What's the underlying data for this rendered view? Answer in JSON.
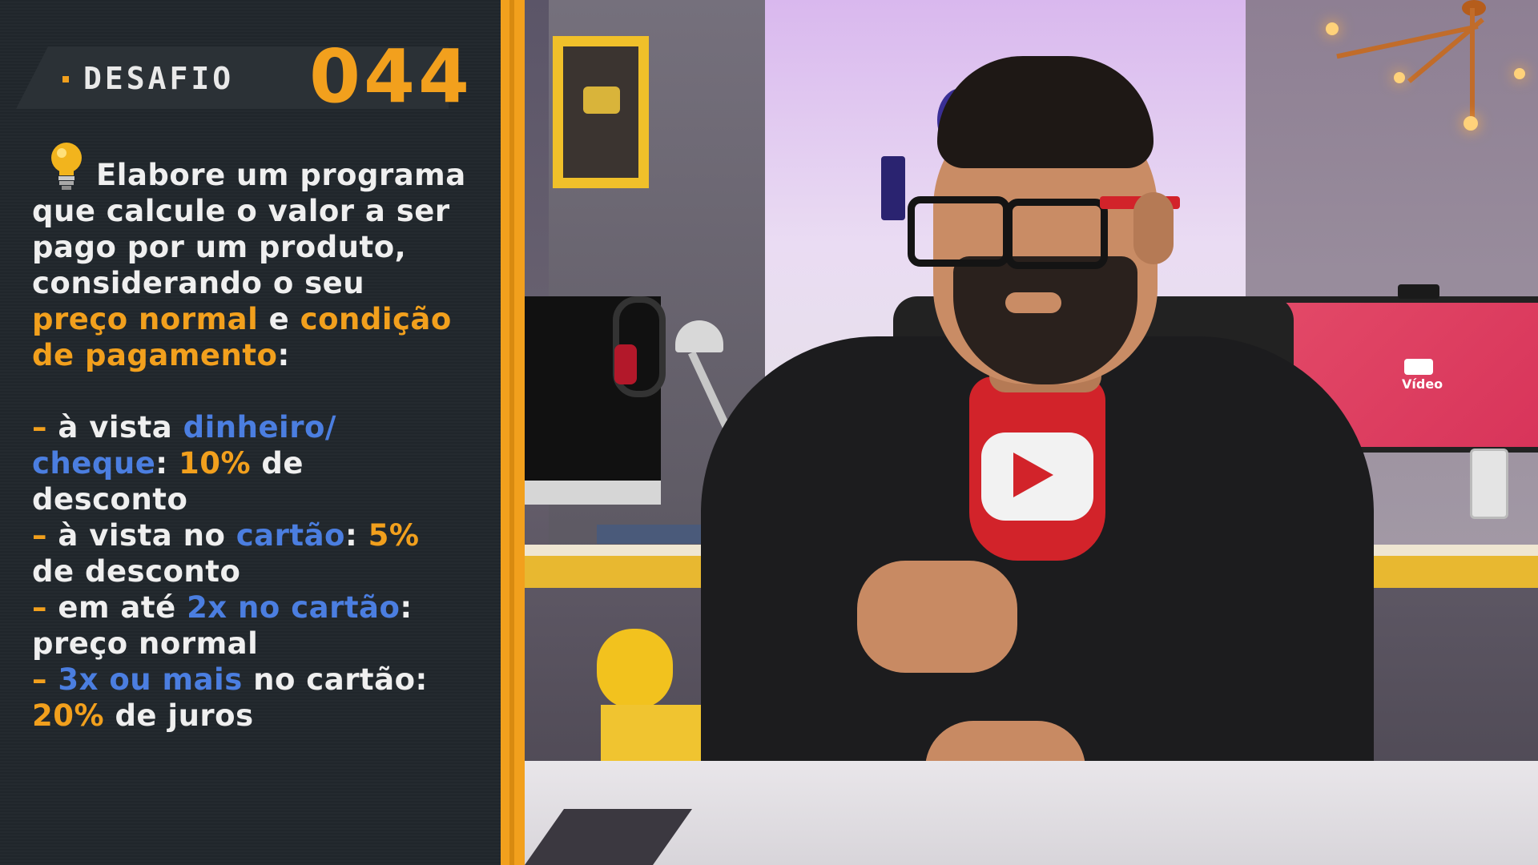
{
  "header": {
    "label": "DESAFIO",
    "number": "044"
  },
  "challenge": {
    "intro": [
      "Elabore um programa",
      "que calcule o valor a ser",
      "pago por um produto,",
      "considerando o seu"
    ],
    "price_term": "preço normal",
    "conj": " e ",
    "condition_term_1": "condição",
    "condition_term_2": "de pagamento",
    "colon": ":",
    "items": [
      {
        "dash": "– ",
        "text_a": "à vista ",
        "hl_a": "dinheiro/",
        "hl_b": "cheque",
        "text_b": ": ",
        "value": "10%",
        "text_c": " de",
        "text_d": "desconto"
      },
      {
        "dash": "– ",
        "text_a": "à vista no ",
        "hl_a": "cartão",
        "text_b": ": ",
        "value": "5%",
        "text_d": "de desconto"
      },
      {
        "dash": "– ",
        "text_a": "em até ",
        "hl_a": "2x no cartão",
        "text_b": ":",
        "text_d": "preço normal"
      },
      {
        "dash": "– ",
        "hl_a": "3x ou mais",
        "text_a": " no cartão:",
        "value": "20%",
        "text_d": " de juros"
      }
    ]
  },
  "scene": {
    "monitor_label": "Vídeo"
  },
  "colors": {
    "accent_orange": "#f2a01d",
    "accent_blue": "#4b7ee0",
    "panel_bg": "#20262b",
    "text": "#efefef"
  }
}
